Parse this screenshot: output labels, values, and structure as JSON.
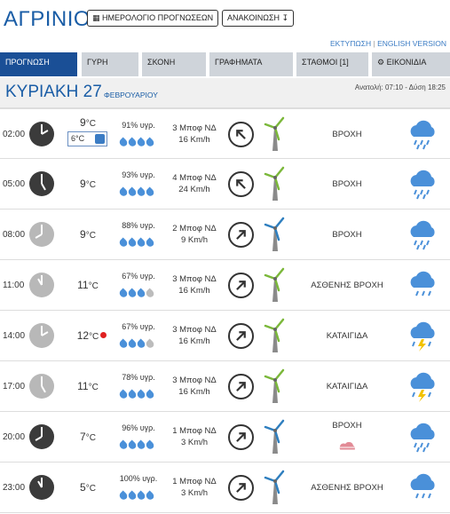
{
  "header": {
    "city": "ΑΓΡΙΝΙΟ",
    "calendar_button": "ΗΜΕΡΟΛΟΓΙΟ ΠΡΟΓΝΩΣΕΩΝ",
    "announcement_button": "ΑΝΑΚΟΙΝΩΣΗ",
    "print_link": "ΕΚΤΥΠΩΣΗ",
    "english_link": "ENGLISH VERSION"
  },
  "tabs": [
    {
      "label": "ΠΡΟΓΝΩΣΗ",
      "active": true
    },
    {
      "label": "ΓΥΡΗ",
      "active": false
    },
    {
      "label": "ΣΚΟΝΗ",
      "active": false
    },
    {
      "label": "ΓΡΑΦΗΜΑΤΑ",
      "active": false
    },
    {
      "label": "ΣΤΑΘΜΟΙ [1]",
      "active": false
    },
    {
      "label": "ΕΙΚΟΝΙΔΙΑ",
      "active": false
    }
  ],
  "day": {
    "name": "ΚΥΡΙΑΚΗ 27",
    "month": "ΦΕΒΡΟΥΑΡΙΟΥ",
    "sun": "Ανατολή: 07:10 - Δύση 18:25"
  },
  "colors": {
    "brand_blue": "#1a5da6",
    "active_tab": "#1a4f96",
    "tab_bg": "#cfd4da",
    "drop_blue": "#4a90d9",
    "drop_grey": "#bcbcbc",
    "turbine_green": "#7bb83a",
    "turbine_blue": "#2f7fbf",
    "hot_marker": "#e02020",
    "mist_pink": "#e28b96"
  },
  "rows": [
    {
      "time": "02:00",
      "clock": "night",
      "temp": "9",
      "unit": "°C",
      "feels": "6°C",
      "hot": false,
      "humidity": "91% υγρ.",
      "drops": 4,
      "wind_bf": "3 Μποφ ΝΔ",
      "wind_kmh": "16 Km/h",
      "wind_dir": "northwest",
      "turbine": "green",
      "condition": "ΒΡΟΧΗ",
      "mist": false,
      "icon": "rain-cloud-icon"
    },
    {
      "time": "05:00",
      "clock": "night",
      "temp": "9",
      "unit": "°C",
      "feels": "",
      "hot": false,
      "humidity": "93% υγρ.",
      "drops": 4,
      "wind_bf": "4 Μποφ ΝΔ",
      "wind_kmh": "24 Km/h",
      "wind_dir": "northwest",
      "turbine": "green",
      "condition": "ΒΡΟΧΗ",
      "mist": false,
      "icon": "rain-cloud-icon"
    },
    {
      "time": "08:00",
      "clock": "day",
      "temp": "9",
      "unit": "°C",
      "feels": "",
      "hot": false,
      "humidity": "88% υγρ.",
      "drops": 4,
      "wind_bf": "2 Μποφ ΝΔ",
      "wind_kmh": "9 Km/h",
      "wind_dir": "northeast",
      "turbine": "blue",
      "condition": "ΒΡΟΧΗ",
      "mist": false,
      "icon": "rain-cloud-icon"
    },
    {
      "time": "11:00",
      "clock": "day",
      "temp": "11",
      "unit": "°C",
      "feels": "",
      "hot": false,
      "humidity": "67% υγρ.",
      "drops": 3,
      "wind_bf": "3 Μποφ ΝΔ",
      "wind_kmh": "16 Km/h",
      "wind_dir": "northeast",
      "turbine": "green",
      "condition": "ΑΣΘΕΝΗΣ ΒΡΟΧΗ",
      "mist": false,
      "icon": "light-rain-cloud-icon"
    },
    {
      "time": "14:00",
      "clock": "day",
      "temp": "12",
      "unit": "°C",
      "feels": "",
      "hot": true,
      "humidity": "67% υγρ.",
      "drops": 3,
      "wind_bf": "3 Μποφ ΝΔ",
      "wind_kmh": "16 Km/h",
      "wind_dir": "northeast",
      "turbine": "green",
      "condition": "ΚΑΤΑΙΓΙΔΑ",
      "mist": false,
      "icon": "thunderstorm-cloud-icon"
    },
    {
      "time": "17:00",
      "clock": "day",
      "temp": "11",
      "unit": "°C",
      "feels": "",
      "hot": false,
      "humidity": "78% υγρ.",
      "drops": 4,
      "wind_bf": "3 Μποφ ΝΔ",
      "wind_kmh": "16 Km/h",
      "wind_dir": "northeast",
      "turbine": "green",
      "condition": "ΚΑΤΑΙΓΙΔΑ",
      "mist": false,
      "icon": "thunderstorm-cloud-icon"
    },
    {
      "time": "20:00",
      "clock": "night",
      "temp": "7",
      "unit": "°C",
      "feels": "",
      "hot": false,
      "humidity": "96% υγρ.",
      "drops": 4,
      "wind_bf": "1 Μποφ ΝΔ",
      "wind_kmh": "3 Km/h",
      "wind_dir": "northeast",
      "turbine": "blue",
      "condition": "ΒΡΟΧΗ",
      "mist": true,
      "icon": "rain-cloud-icon"
    },
    {
      "time": "23:00",
      "clock": "night",
      "temp": "5",
      "unit": "°C",
      "feels": "",
      "hot": false,
      "humidity": "100% υγρ.",
      "drops": 4,
      "wind_bf": "1 Μποφ ΝΔ",
      "wind_kmh": "3 Km/h",
      "wind_dir": "northeast",
      "turbine": "blue",
      "condition": "ΑΣΘΕΝΗΣ ΒΡΟΧΗ",
      "mist": false,
      "icon": "light-rain-cloud-icon"
    }
  ]
}
